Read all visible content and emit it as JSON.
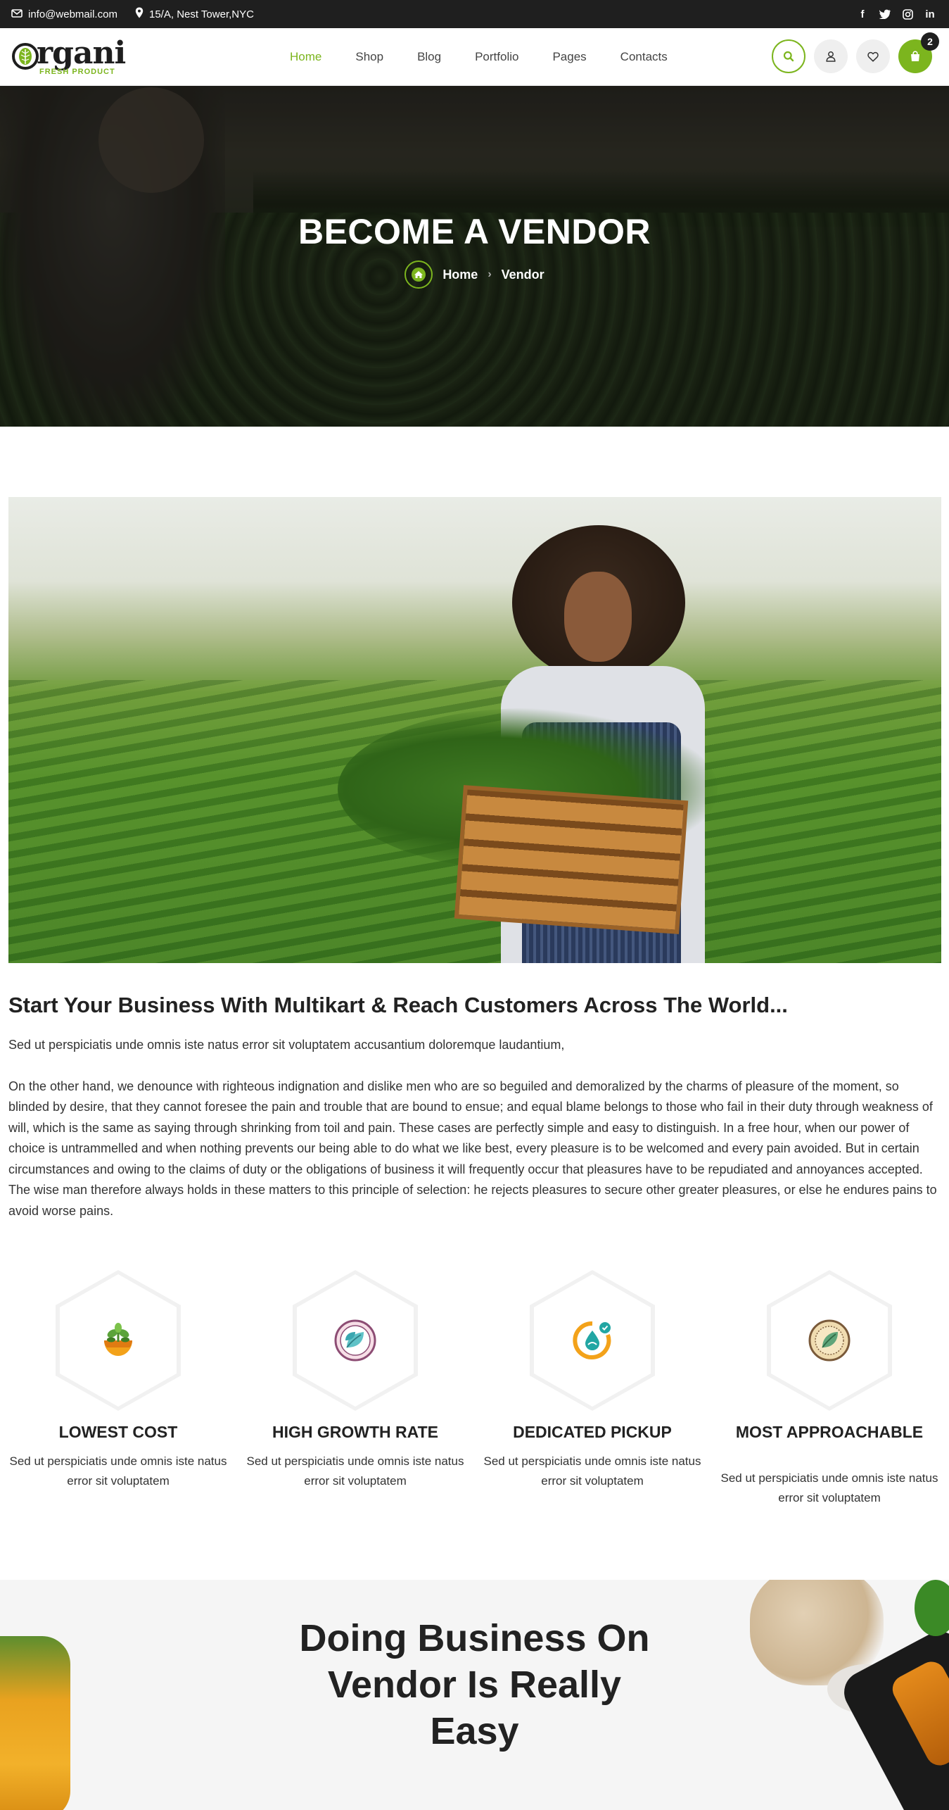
{
  "topbar": {
    "email": "info@webmail.com",
    "address": "15/A, Nest Tower,NYC",
    "socials": [
      "facebook-icon",
      "twitter-icon",
      "instagram-icon",
      "linkedin-icon"
    ]
  },
  "header": {
    "logo_text": "rgani",
    "logo_tagline": "FRESH PRODUCT",
    "nav": [
      "Home",
      "Shop",
      "Blog",
      "Portfolio",
      "Pages",
      "Contacts"
    ],
    "active_nav": "Home",
    "cart_count": "2"
  },
  "hero": {
    "title": "BECOME A VENDOR",
    "breadcrumb": [
      "Home",
      "Vendor"
    ]
  },
  "intro": {
    "heading": "Start Your Business With Multikart & Reach Customers Across The World...",
    "para1": "Sed ut perspiciatis unde omnis iste natus error sit voluptatem accusantium doloremque laudantium,",
    "para2": "On the other hand, we denounce with righteous indignation and dislike men who are so beguiled and demoralized by the charms of pleasure of the moment, so blinded by desire, that they cannot foresee the pain and trouble that are bound to ensue; and equal blame belongs to those who fail in their duty through weakness of will, which is the same as saying through shrinking from toil and pain. These cases are perfectly simple and easy to distinguish. In a free hour, when our power of choice is untrammelled and when nothing prevents our being able to do what we like best, every pleasure is to be welcomed and every pain avoided. But in certain circumstances and owing to the claims of duty or the obligations of business it will frequently occur that pleasures have to be repudiated and annoyances accepted. The wise man therefore always holds in these matters to this principle of selection: he rejects pleasures to secure other greater pleasures, or else he endures pains to avoid worse pains."
  },
  "features": [
    {
      "title": "LOWEST COST",
      "text": "Sed ut perspiciatis unde omnis iste natus error sit voluptatem",
      "icon": "plant-growth-icon"
    },
    {
      "title": "HIGH GROWTH RATE",
      "text": "Sed ut perspiciatis unde omnis iste natus error sit voluptatem",
      "icon": "leaves-icon"
    },
    {
      "title": "DEDICATED PICKUP",
      "text": "Sed ut perspiciatis unde omnis iste natus error sit voluptatem",
      "icon": "water-drop-icon"
    },
    {
      "title": "MOST APPROACHABLE",
      "text": "Sed ut perspiciatis unde omnis iste natus error sit voluptatem",
      "icon": "organic-leaf-badge-icon"
    }
  ],
  "bottom": {
    "heading": "Doing Business On Vendor Is Really Easy"
  },
  "colors": {
    "accent": "#7cb51e",
    "dark": "#1f1f1f"
  }
}
